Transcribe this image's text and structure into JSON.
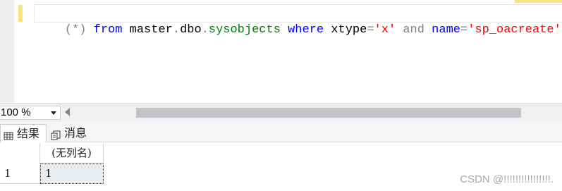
{
  "editor": {
    "line_tokens": [
      {
        "text": "(*) ",
        "kind": "gray"
      },
      {
        "text": "from",
        "kind": "kw"
      },
      {
        "text": " master",
        "kind": "id"
      },
      {
        "text": ".",
        "kind": "gray"
      },
      {
        "text": "dbo",
        "kind": "id"
      },
      {
        "text": ".",
        "kind": "gray"
      },
      {
        "text": "sysobjects",
        "kind": "obj"
      },
      {
        "text": " where",
        "kind": "kw"
      },
      {
        "text": " xtype",
        "kind": "id"
      },
      {
        "text": "=",
        "kind": "gray"
      },
      {
        "text": "'x'",
        "kind": "str"
      },
      {
        "text": " and",
        "kind": "gray"
      },
      {
        "text": " name",
        "kind": "kw"
      },
      {
        "text": "=",
        "kind": "gray"
      },
      {
        "text": "'sp_oacreate'",
        "kind": "str"
      }
    ]
  },
  "zoom": {
    "value": "100 %"
  },
  "tabs": {
    "results_label": "结果",
    "messages_label": "消息"
  },
  "grid": {
    "column_header": "(无列名)",
    "rows": [
      {
        "row_number": "1",
        "value": "1"
      }
    ]
  },
  "watermark": "CSDN @!!!!!!!!!!!!!!!!.",
  "colors": {
    "keyword": "#0000ff",
    "object": "#008000",
    "string": "#ff0000",
    "operator": "#808080",
    "change_bar": "#f7e37a",
    "selected_cell": "#e8ecf1"
  }
}
